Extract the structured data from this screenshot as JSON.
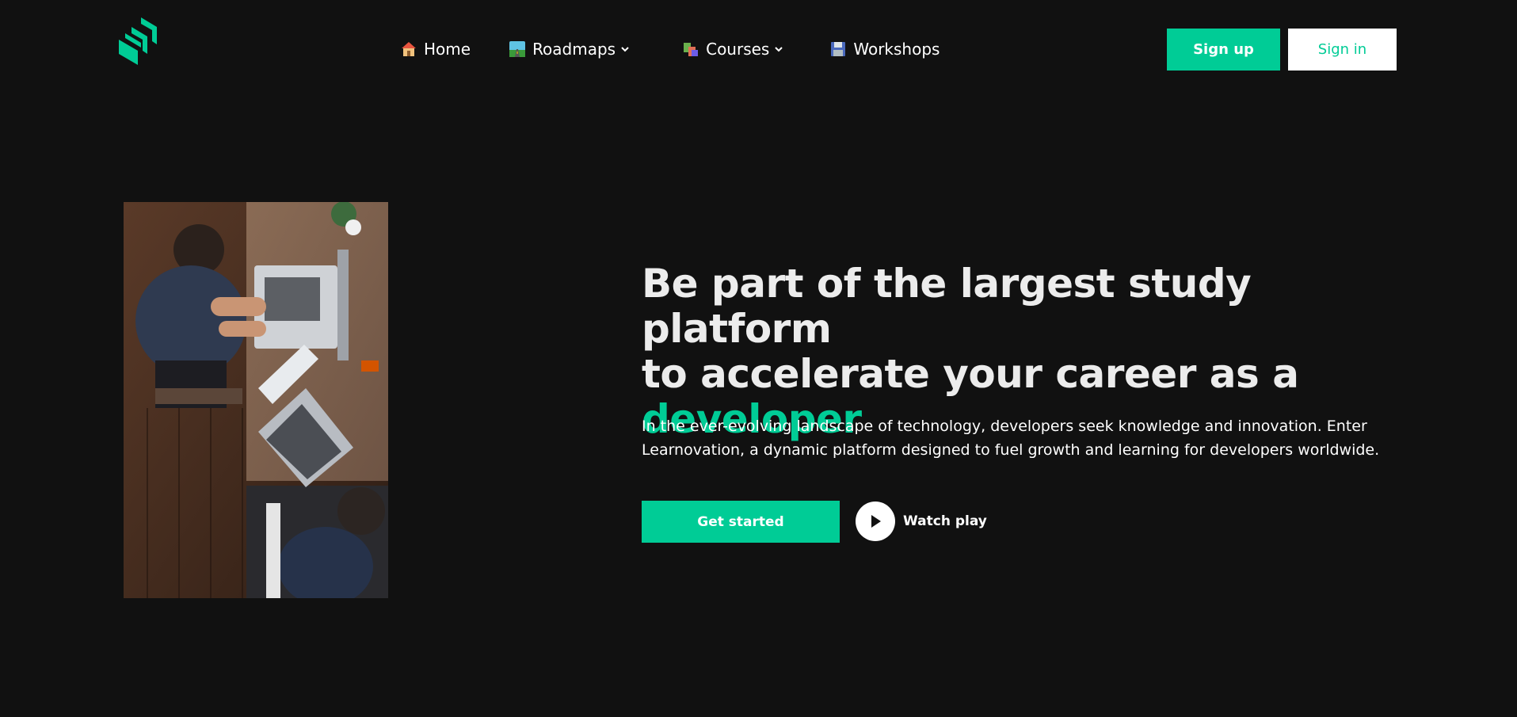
{
  "colors": {
    "background": "#111111",
    "accent": "#00cc96",
    "text": "#ffffff"
  },
  "header": {
    "logo_icon": "stacked-bars-logo-icon",
    "nav": [
      {
        "label": "Home",
        "icon": "house-icon"
      },
      {
        "label": "Roadmaps",
        "icon": "road-icon",
        "has_dropdown": true
      },
      {
        "label": "Courses",
        "icon": "books-icon",
        "has_dropdown": true
      },
      {
        "label": "Workshops",
        "icon": "floppy-disk-icon"
      }
    ],
    "signup_label": "Sign up",
    "signin_label": "Sign in"
  },
  "hero": {
    "title_line1": "Be part of the largest study platform",
    "title_line2": "to accelerate your career as a",
    "title_accent": "developer",
    "description": "In the ever-evolving landscape of technology, developers seek knowledge and innovation. Enter Learnovation, a dynamic platform designed to fuel growth and learning for developers worldwide.",
    "cta_label": "Get started",
    "watch_label": "Watch play"
  }
}
